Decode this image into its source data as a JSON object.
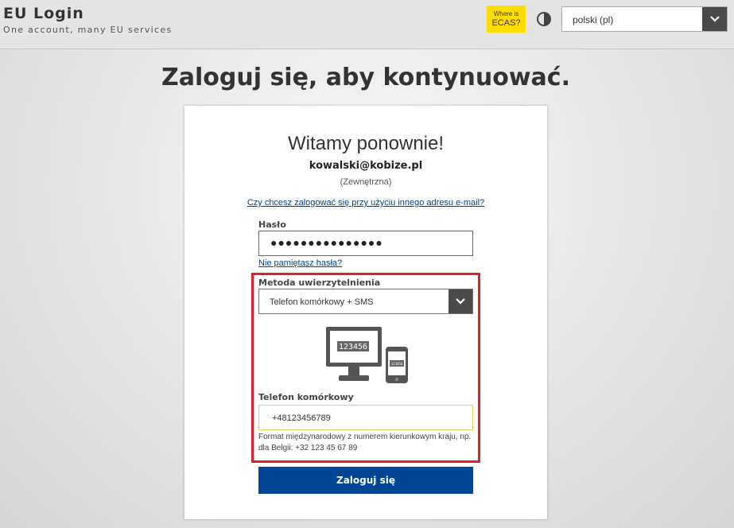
{
  "header": {
    "title": "EU Login",
    "subtitle": "One account, many EU services",
    "ecas_line1": "Where is",
    "ecas_line2": "ECAS?",
    "ecas_color": "#ffdd00",
    "contrast_icon": "contrast-icon",
    "language_selected": "polski (pl)"
  },
  "main": {
    "heading": "Zaloguj się, aby kontynuować."
  },
  "card": {
    "welcome": "Witamy ponownie!",
    "email": "kowalski@kobize.pl",
    "user_type": "(Zewnętrzna)",
    "other_email_link": "Czy chcesz zalogować się przy użyciu innego adresu e-mail?",
    "password_label": "Hasło",
    "password_value": "●●●●●●●●●●●●●●●",
    "forgot_password_link": "Nie pamiętasz hasła?",
    "method_label": "Metoda uwierzytelnienia",
    "method_value": "Telefon komórkowy + SMS",
    "illustration": {
      "icon": "desktop-and-phone-icon",
      "screen_code": "123456",
      "phone_code": "123456"
    },
    "phone_label": "Telefon komórkowy",
    "phone_value": "+48123456789",
    "phone_help": "Format międzynarodowy z numerem kierunkowym kraju, np. dla Belgii: +32 123 45 67 89",
    "login_button": "Zaloguj się",
    "highlight_color": "#e0202a",
    "button_color": "#004494"
  }
}
